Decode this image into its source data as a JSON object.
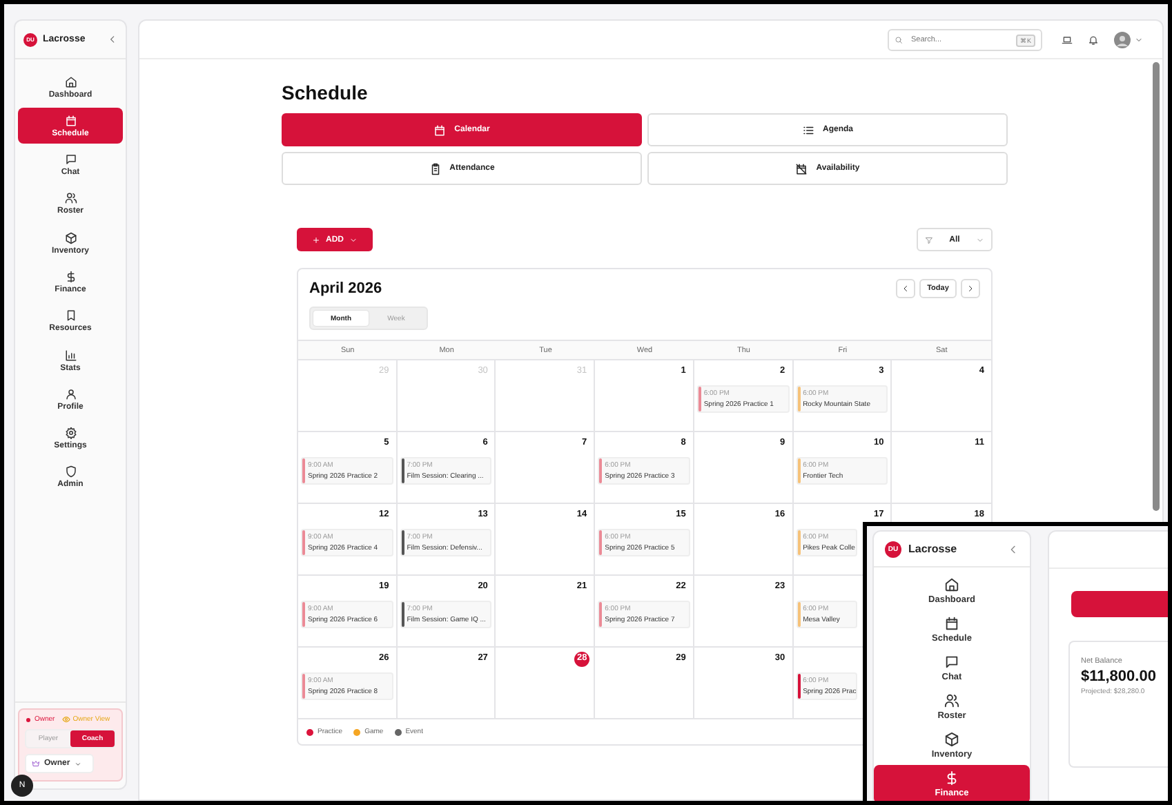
{
  "sidebar": {
    "logo": "DU",
    "brand": "Lacrosse",
    "items": [
      {
        "label": "Dashboard",
        "selected": false
      },
      {
        "label": "Schedule",
        "selected": true
      },
      {
        "label": "Chat",
        "selected": false
      },
      {
        "label": "Roster",
        "selected": false
      },
      {
        "label": "Inventory",
        "selected": false
      },
      {
        "label": "Finance",
        "selected": false
      },
      {
        "label": "Resources",
        "selected": false
      },
      {
        "label": "Stats",
        "selected": false
      },
      {
        "label": "Profile",
        "selected": false
      },
      {
        "label": "Settings",
        "selected": false
      },
      {
        "label": "Admin",
        "selected": false
      }
    ],
    "role_legend": [
      {
        "label": "Owner",
        "kind": "dot",
        "color": "#dc143c"
      },
      {
        "label": "Owner View",
        "kind": "eye",
        "color": "#e6a817"
      }
    ],
    "role_toggle": [
      {
        "label": "Player",
        "selected": false
      },
      {
        "label": "Coach",
        "selected": true
      }
    ],
    "role_select": "Owner"
  },
  "dev_badge": "N",
  "topbar": {
    "search": {
      "placeholder": "Search...",
      "shortcut": "⌘K"
    }
  },
  "page": {
    "title": "Schedule",
    "views": [
      {
        "label": "Calendar",
        "selected": true
      },
      {
        "label": "Agenda",
        "selected": false
      },
      {
        "label": "Attendance",
        "selected": false
      },
      {
        "label": "Availability",
        "selected": false
      }
    ],
    "add_button": "ADD",
    "filter": "All"
  },
  "calendar": {
    "title": "April 2026",
    "today_button": "Today",
    "modes": [
      {
        "label": "Month",
        "selected": true
      },
      {
        "label": "Week",
        "selected": false
      }
    ],
    "weekdays": [
      "Sun",
      "Mon",
      "Tue",
      "Wed",
      "Thu",
      "Fri",
      "Sat"
    ],
    "weeks": [
      [
        {
          "day": "29",
          "outside": true,
          "today": false
        },
        {
          "day": "30",
          "outside": true,
          "today": false
        },
        {
          "day": "31",
          "outside": true,
          "today": false
        },
        {
          "day": "1",
          "outside": false,
          "today": false
        },
        {
          "day": "2",
          "outside": false,
          "today": false,
          "events": [
            {
              "time": "6:00 PM",
              "title": "Spring 2026 Practice 1",
              "color": "#eb8a96"
            }
          ]
        },
        {
          "day": "3",
          "outside": false,
          "today": false,
          "events": [
            {
              "time": "6:00 PM",
              "title": "Rocky Mountain State",
              "color": "#f6c27a"
            }
          ]
        },
        {
          "day": "4",
          "outside": false,
          "today": false
        }
      ],
      [
        {
          "day": "5",
          "outside": false,
          "today": false,
          "events": [
            {
              "time": "9:00 AM",
              "title": "Spring 2026 Practice 2",
              "color": "#eb8a96"
            }
          ]
        },
        {
          "day": "6",
          "outside": false,
          "today": false,
          "events": [
            {
              "time": "7:00 PM",
              "title": "Film Session: Clearing ...",
              "color": "#555555"
            }
          ]
        },
        {
          "day": "7",
          "outside": false,
          "today": false
        },
        {
          "day": "8",
          "outside": false,
          "today": false,
          "events": [
            {
              "time": "6:00 PM",
              "title": "Spring 2026 Practice 3",
              "color": "#eb8a96"
            }
          ]
        },
        {
          "day": "9",
          "outside": false,
          "today": false
        },
        {
          "day": "10",
          "outside": false,
          "today": false,
          "events": [
            {
              "time": "6:00 PM",
              "title": "Frontier Tech",
              "color": "#f6c27a"
            }
          ]
        },
        {
          "day": "11",
          "outside": false,
          "today": false
        }
      ],
      [
        {
          "day": "12",
          "outside": false,
          "today": false,
          "events": [
            {
              "time": "9:00 AM",
              "title": "Spring 2026 Practice 4",
              "color": "#eb8a96"
            }
          ]
        },
        {
          "day": "13",
          "outside": false,
          "today": false,
          "events": [
            {
              "time": "7:00 PM",
              "title": "Film Session: Defensiv...",
              "color": "#555555"
            }
          ]
        },
        {
          "day": "14",
          "outside": false,
          "today": false
        },
        {
          "day": "15",
          "outside": false,
          "today": false,
          "events": [
            {
              "time": "6:00 PM",
              "title": "Spring 2026 Practice 5",
              "color": "#eb8a96"
            }
          ]
        },
        {
          "day": "16",
          "outside": false,
          "today": false
        },
        {
          "day": "17",
          "outside": false,
          "today": false,
          "events": [
            {
              "time": "6:00 PM",
              "title": "Pikes Peak Colle",
              "color": "#f6c27a"
            }
          ]
        },
        {
          "day": "18",
          "outside": false,
          "today": false
        }
      ],
      [
        {
          "day": "19",
          "outside": false,
          "today": false,
          "events": [
            {
              "time": "9:00 AM",
              "title": "Spring 2026 Practice 6",
              "color": "#eb8a96"
            }
          ]
        },
        {
          "day": "20",
          "outside": false,
          "today": false,
          "events": [
            {
              "time": "7:00 PM",
              "title": "Film Session: Game IQ ...",
              "color": "#555555"
            }
          ]
        },
        {
          "day": "21",
          "outside": false,
          "today": false
        },
        {
          "day": "22",
          "outside": false,
          "today": false,
          "events": [
            {
              "time": "6:00 PM",
              "title": "Spring 2026 Practice 7",
              "color": "#eb8a96"
            }
          ]
        },
        {
          "day": "23",
          "outside": false,
          "today": false
        },
        {
          "events": [
            {
              "time": "6:00 PM",
              "title": "Mesa Valley",
              "color": "#f6c27a"
            }
          ]
        }
      ],
      [
        {
          "day": "26",
          "outside": false,
          "today": false,
          "events": [
            {
              "time": "9:00 AM",
              "title": "Spring 2026 Practice 8",
              "color": "#eb8a96"
            }
          ]
        },
        {
          "day": "27",
          "outside": false,
          "today": false
        },
        {
          "day": "28",
          "outside": false,
          "today": true
        },
        {
          "day": "29",
          "outside": false,
          "today": false
        },
        {
          "day": "30",
          "outside": false,
          "today": false
        },
        {
          "events": [
            {
              "time": "6:00 PM",
              "title": "Spring 2026 Prac",
              "color": "#d6123a"
            }
          ]
        }
      ]
    ],
    "legend": [
      {
        "label": "Practice",
        "color": "#dc143c"
      },
      {
        "label": "Game",
        "color": "#f5a623"
      },
      {
        "label": "Event",
        "color": "#666666"
      }
    ]
  },
  "inset": {
    "logo": "DU",
    "brand": "Lacrosse",
    "items": [
      {
        "label": "Dashboard",
        "selected": false
      },
      {
        "label": "Schedule",
        "selected": false
      },
      {
        "label": "Chat",
        "selected": false
      },
      {
        "label": "Roster",
        "selected": false
      },
      {
        "label": "Inventory",
        "selected": false
      },
      {
        "label": "Finance",
        "selected": true
      }
    ],
    "card": {
      "label": "Net Balance",
      "value": "$11,800.00",
      "note": "Projected: $28,280.0"
    }
  }
}
